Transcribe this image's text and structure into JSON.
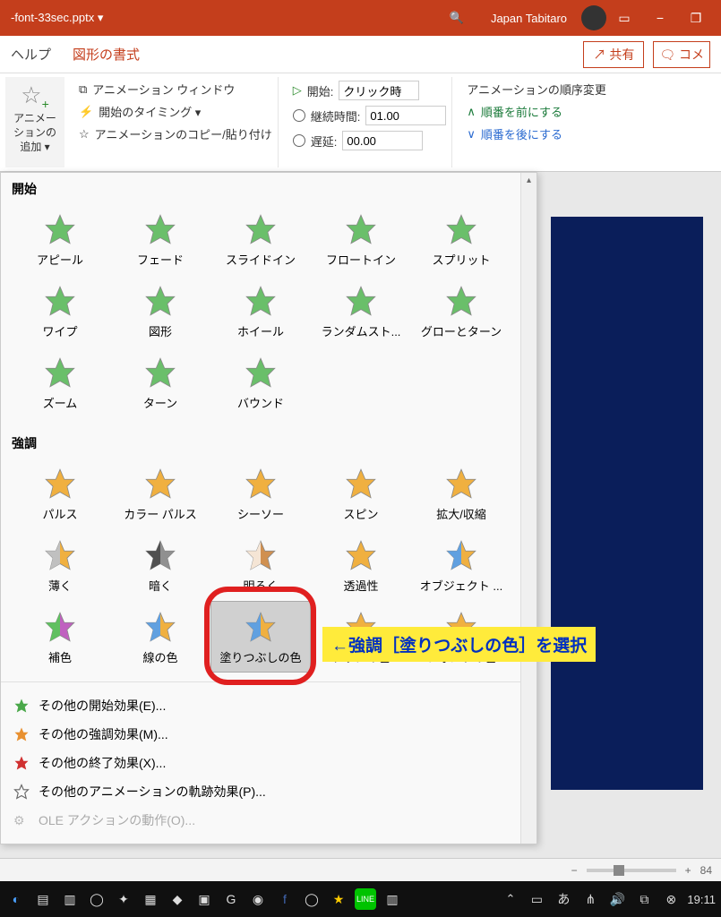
{
  "title": {
    "filename": "-font-33sec.pptx ▾",
    "user": "Japan Tabitaro"
  },
  "tabs": {
    "help": "ヘルプ",
    "shapefmt": "図形の書式",
    "share": "共有",
    "comment": "コメ"
  },
  "ribbon": {
    "addanim": "アニメーションの追加 ▾",
    "animwin": "アニメーション ウィンドウ",
    "timing": "開始のタイミング ▾",
    "copypaste": "アニメーションのコピー/貼り付け",
    "start_label": "開始:",
    "start_value": "クリック時",
    "duration_label": "継続時間:",
    "duration_value": "01.00",
    "delay_label": "遅延:",
    "delay_value": "00.00",
    "reorder_title": "アニメーションの順序変更",
    "move_earlier": "順番を前にする",
    "move_later": "順番を後にする"
  },
  "gallery": {
    "entrance_title": "開始",
    "entrance": [
      "アピール",
      "フェード",
      "スライドイン",
      "フロートイン",
      "スプリット",
      "ワイプ",
      "図形",
      "ホイール",
      "ランダムスト...",
      "グローとターン",
      "ズーム",
      "ターン",
      "バウンド"
    ],
    "emphasis_title": "強調",
    "emphasis": [
      "パルス",
      "カラー パルス",
      "シーソー",
      "スピン",
      "拡大/収縮",
      "薄く",
      "暗く",
      "明るく",
      "透過性",
      "オブジェクト ...",
      "補色",
      "線の色",
      "塗りつぶしの色",
      "ブラシの色",
      "フォントの色"
    ],
    "more": {
      "entrance": "その他の開始効果(E)...",
      "emphasis": "その他の強調効果(M)...",
      "exit": "その他の終了効果(X)...",
      "motion": "その他のアニメーションの軌跡効果(P)...",
      "ole": "OLE アクションの動作(O)..."
    }
  },
  "callout": "←強調［塗りつぶしの色］を選択",
  "status": {
    "zoom": "84"
  },
  "taskbar": {
    "time": "19:11"
  }
}
